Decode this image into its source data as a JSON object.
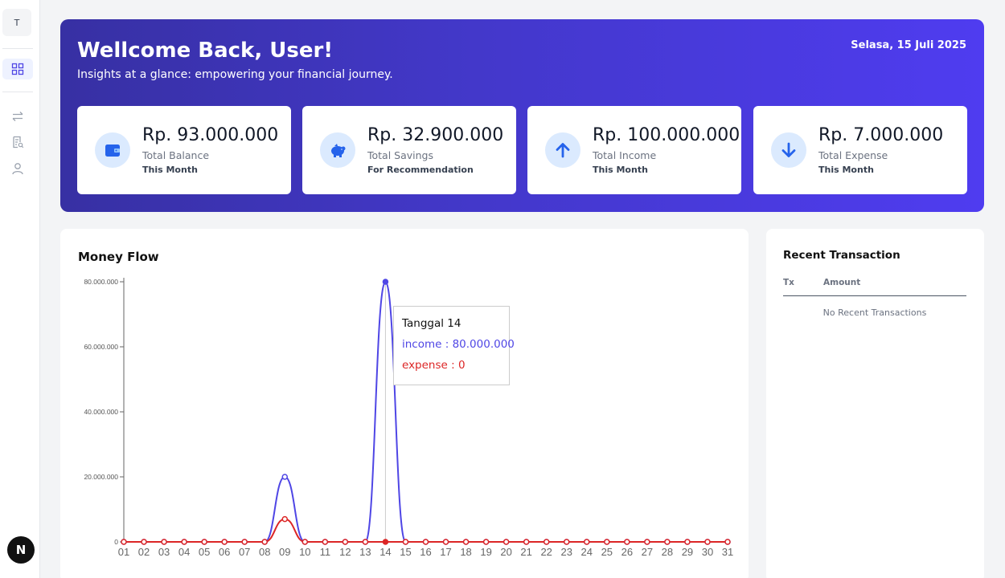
{
  "sidebar": {
    "logo_letter": "T",
    "nav": [
      {
        "name": "dashboard",
        "icon": "grid-icon",
        "active": true
      },
      {
        "name": "transfer",
        "icon": "swap-icon",
        "active": false
      },
      {
        "name": "report",
        "icon": "document-icon",
        "active": false
      },
      {
        "name": "profile",
        "icon": "user-icon",
        "active": false
      }
    ],
    "badge_letter": "N"
  },
  "hero": {
    "title": "Wellcome Back, User!",
    "subtitle": "Insights at a glance: empowering your financial journey.",
    "date": "Selasa, 15 Juli 2025"
  },
  "stats": [
    {
      "value": "Rp. 93.000.000",
      "label": "Total Balance",
      "note": "This Month",
      "icon": "wallet-icon"
    },
    {
      "value": "Rp. 32.900.000",
      "label": "Total Savings",
      "note": "For Recommendation",
      "icon": "piggy-bank-icon"
    },
    {
      "value": "Rp. 100.000.000",
      "label": "Total Income",
      "note": "This Month",
      "icon": "arrow-up-icon"
    },
    {
      "value": "Rp. 7.000.000",
      "label": "Total Expense",
      "note": "This Month",
      "icon": "arrow-down-icon"
    }
  ],
  "money_flow": {
    "title": "Money Flow",
    "tooltip": {
      "title": "Tanggal 14",
      "income": "income : 80.000.000",
      "expense": "expense : 0"
    }
  },
  "chart_data": {
    "type": "line",
    "x": [
      "01",
      "02",
      "03",
      "04",
      "05",
      "06",
      "07",
      "08",
      "09",
      "10",
      "11",
      "12",
      "13",
      "14",
      "15",
      "16",
      "17",
      "18",
      "19",
      "20",
      "21",
      "22",
      "23",
      "24",
      "25",
      "26",
      "27",
      "28",
      "29",
      "30",
      "31"
    ],
    "series": [
      {
        "name": "income",
        "color": "#4f46e5",
        "values": [
          0,
          0,
          0,
          0,
          0,
          0,
          0,
          0,
          20000000,
          0,
          0,
          0,
          0,
          80000000,
          0,
          0,
          0,
          0,
          0,
          0,
          0,
          0,
          0,
          0,
          0,
          0,
          0,
          0,
          0,
          0,
          0
        ]
      },
      {
        "name": "expense",
        "color": "#dc2626",
        "values": [
          0,
          0,
          0,
          0,
          0,
          0,
          0,
          0,
          7000000,
          0,
          0,
          0,
          0,
          0,
          0,
          0,
          0,
          0,
          0,
          0,
          0,
          0,
          0,
          0,
          0,
          0,
          0,
          0,
          0,
          0,
          0
        ]
      }
    ],
    "yticks": [
      {
        "value": 0,
        "label": "0"
      },
      {
        "value": 20000000,
        "label": "20.000.000"
      },
      {
        "value": 40000000,
        "label": "40.000.000"
      },
      {
        "value": 60000000,
        "label": "60.000.000"
      },
      {
        "value": 80000000,
        "label": "80.000.000"
      }
    ],
    "ylim": [
      0,
      80000000
    ],
    "active_index": 13
  },
  "recent": {
    "title": "Recent Transaction",
    "col_tx": "Tx",
    "col_amount": "Amount",
    "empty_text": "No Recent Transactions"
  }
}
